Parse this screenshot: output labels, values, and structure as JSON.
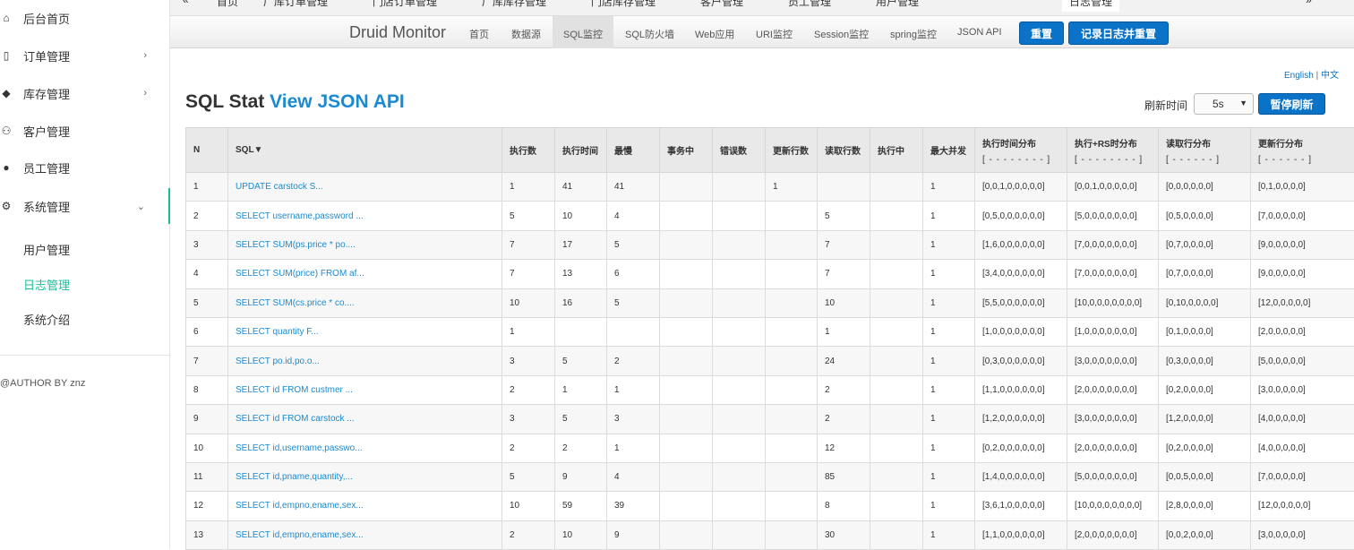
{
  "sidebar": {
    "items": [
      {
        "label": "后台首页",
        "icon": "home-icon"
      },
      {
        "label": "订单管理",
        "icon": "clipboard-icon"
      },
      {
        "label": "库存管理",
        "icon": "cube-icon"
      },
      {
        "label": "客户管理",
        "icon": "users-icon"
      },
      {
        "label": "员工管理",
        "icon": "user-icon"
      },
      {
        "label": "系统管理",
        "icon": "gear-icon"
      }
    ],
    "submenu": [
      "用户管理",
      "日志管理",
      "系统介绍"
    ],
    "author": "@AUTHOR BY znz"
  },
  "tabs": [
    "首页",
    "厂库订单管理",
    "门店订单管理",
    "厂库库存管理",
    "门店库存管理",
    "客户管理",
    "员工管理",
    "用户管理",
    "日志管理"
  ],
  "druid": {
    "brand": "Druid Monitor",
    "nav": [
      "首页",
      "数据源",
      "SQL监控",
      "SQL防火墙",
      "Web应用",
      "URI监控",
      "Session监控",
      "spring监控",
      "JSON API"
    ],
    "reset": "重置",
    "log_reset": "记录日志并重置",
    "lang_en": "English",
    "lang_sep": "|",
    "lang_zh": "中文"
  },
  "page": {
    "title": "SQL Stat",
    "title_link": "View JSON API",
    "refresh_label": "刷新时间",
    "refresh_value": "5s",
    "pause": "暂停刷新"
  },
  "table": {
    "headers": [
      "N",
      "SQL▼",
      "执行数",
      "执行时间",
      "最慢",
      "事务中",
      "错误数",
      "更新行数",
      "读取行数",
      "执行中",
      "最大并发",
      "执行时间分布",
      "执行+RS时分布",
      "读取行分布",
      "更新行分布"
    ],
    "header_subs": [
      "",
      "",
      "",
      "",
      "",
      "",
      "",
      "",
      "",
      "",
      "",
      "[ - - - - - - - - ]",
      "[ - - - - - - - - ]",
      "[ - - - - - - ]",
      "[ - - - - - - ]"
    ],
    "rows": [
      [
        "1",
        "UPDATE carstock S...",
        "1",
        "41",
        "41",
        "",
        "",
        "1",
        "",
        "",
        "1",
        "[0,0,1,0,0,0,0,0]",
        "[0,0,1,0,0,0,0,0]",
        "[0,0,0,0,0,0]",
        "[0,1,0,0,0,0]"
      ],
      [
        "2",
        "SELECT username,password ...",
        "5",
        "10",
        "4",
        "",
        "",
        "",
        "5",
        "",
        "1",
        "[0,5,0,0,0,0,0,0]",
        "[5,0,0,0,0,0,0,0]",
        "[0,5,0,0,0,0]",
        "[7,0,0,0,0,0]"
      ],
      [
        "3",
        "SELECT SUM(ps.price * po....",
        "7",
        "17",
        "5",
        "",
        "",
        "",
        "7",
        "",
        "1",
        "[1,6,0,0,0,0,0,0]",
        "[7,0,0,0,0,0,0,0]",
        "[0,7,0,0,0,0]",
        "[9,0,0,0,0,0]"
      ],
      [
        "4",
        "SELECT SUM(price) FROM af...",
        "7",
        "13",
        "6",
        "",
        "",
        "",
        "7",
        "",
        "1",
        "[3,4,0,0,0,0,0,0]",
        "[7,0,0,0,0,0,0,0]",
        "[0,7,0,0,0,0]",
        "[9,0,0,0,0,0]"
      ],
      [
        "5",
        "SELECT SUM(cs.price * co....",
        "10",
        "16",
        "5",
        "",
        "",
        "",
        "10",
        "",
        "1",
        "[5,5,0,0,0,0,0,0]",
        "[10,0,0,0,0,0,0,0]",
        "[0,10,0,0,0,0]",
        "[12,0,0,0,0,0]"
      ],
      [
        "6",
        "SELECT quantity F...",
        "1",
        "",
        "",
        "",
        "",
        "",
        "1",
        "",
        "1",
        "[1,0,0,0,0,0,0,0]",
        "[1,0,0,0,0,0,0,0]",
        "[0,1,0,0,0,0]",
        "[2,0,0,0,0,0]"
      ],
      [
        "7",
        "SELECT po.id,po.o...",
        "3",
        "5",
        "2",
        "",
        "",
        "",
        "24",
        "",
        "1",
        "[0,3,0,0,0,0,0,0]",
        "[3,0,0,0,0,0,0,0]",
        "[0,3,0,0,0,0]",
        "[5,0,0,0,0,0]"
      ],
      [
        "8",
        "SELECT id FROM custmer ...",
        "2",
        "1",
        "1",
        "",
        "",
        "",
        "2",
        "",
        "1",
        "[1,1,0,0,0,0,0,0]",
        "[2,0,0,0,0,0,0,0]",
        "[0,2,0,0,0,0]",
        "[3,0,0,0,0,0]"
      ],
      [
        "9",
        "SELECT id FROM carstock ...",
        "3",
        "5",
        "3",
        "",
        "",
        "",
        "2",
        "",
        "1",
        "[1,2,0,0,0,0,0,0]",
        "[3,0,0,0,0,0,0,0]",
        "[1,2,0,0,0,0]",
        "[4,0,0,0,0,0]"
      ],
      [
        "10",
        "SELECT id,username,passwo...",
        "2",
        "2",
        "1",
        "",
        "",
        "",
        "12",
        "",
        "1",
        "[0,2,0,0,0,0,0,0]",
        "[2,0,0,0,0,0,0,0]",
        "[0,2,0,0,0,0]",
        "[4,0,0,0,0,0]"
      ],
      [
        "11",
        "SELECT id,pname,quantity,...",
        "5",
        "9",
        "4",
        "",
        "",
        "",
        "85",
        "",
        "1",
        "[1,4,0,0,0,0,0,0]",
        "[5,0,0,0,0,0,0,0]",
        "[0,0,5,0,0,0]",
        "[7,0,0,0,0,0]"
      ],
      [
        "12",
        "SELECT id,empno,ename,sex...",
        "10",
        "59",
        "39",
        "",
        "",
        "",
        "8",
        "",
        "1",
        "[3,6,1,0,0,0,0,0]",
        "[10,0,0,0,0,0,0,0]",
        "[2,8,0,0,0,0]",
        "[12,0,0,0,0,0]"
      ],
      [
        "13",
        "SELECT id,empno,ename,sex...",
        "2",
        "10",
        "9",
        "",
        "",
        "",
        "30",
        "",
        "1",
        "[1,1,0,0,0,0,0,0]",
        "[2,0,0,0,0,0,0,0]",
        "[0,0,2,0,0,0]",
        "[3,0,0,0,0,0]"
      ]
    ]
  },
  "colors": {
    "accent": "#1abc9c",
    "primary": "#0a72c7",
    "link": "#1a8ad2"
  }
}
